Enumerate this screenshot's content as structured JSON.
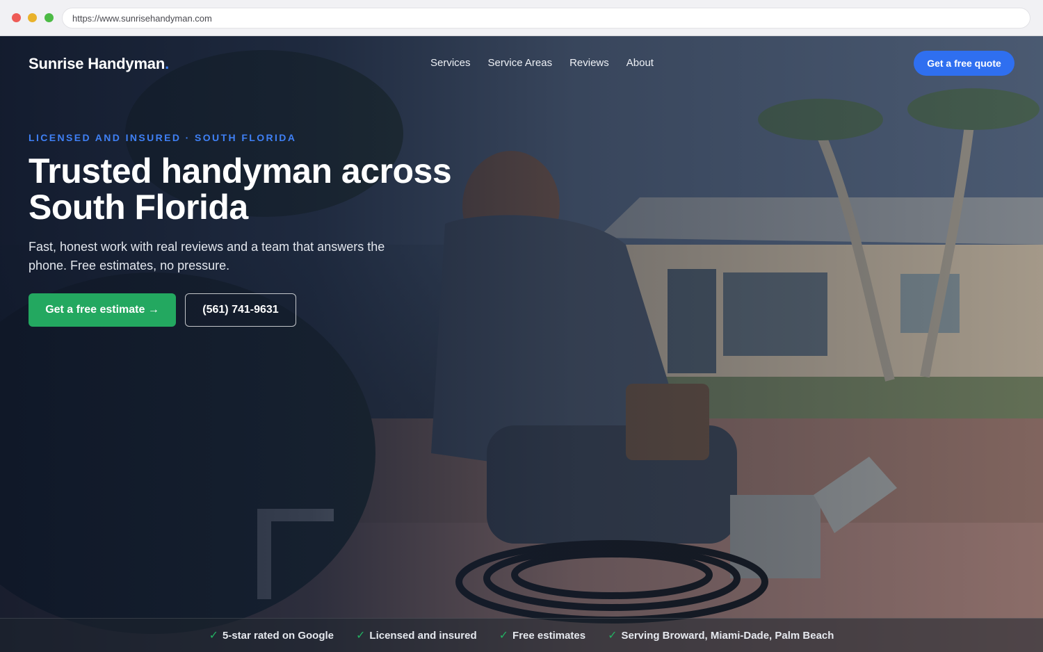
{
  "browser": {
    "url": "https://www.sunrisehandyman.com"
  },
  "site": {
    "logo_text": "Sunrise Handyman",
    "logo_accent": ".",
    "nav": [
      {
        "label": "Services"
      },
      {
        "label": "Service Areas"
      },
      {
        "label": "Reviews"
      },
      {
        "label": "About"
      }
    ],
    "cta_label": "Get a free quote"
  },
  "hero": {
    "eyebrow": "LICENSED AND INSURED · SOUTH FLORIDA",
    "headline_line1": "Trusted handyman across",
    "headline_line2": "South Florida",
    "subtext": "Fast, honest work with real reviews and a team that answers the phone. Free estimates, no pressure.",
    "primary_button": "Get a free estimate →",
    "phone_button": "(561) 741-9631"
  },
  "trust_bar": {
    "check_icon": "✓",
    "items": [
      {
        "label": "5-star rated on Google"
      },
      {
        "label": "Licensed and insured"
      },
      {
        "label": "Free estimates"
      },
      {
        "label": "Serving Broward, Miami-Dade, Palm Beach"
      }
    ]
  },
  "colors": {
    "accent_blue": "#2f6ff0",
    "eyebrow_blue": "#3f80f5",
    "primary_green": "#23a860",
    "check_green": "#23b062"
  }
}
